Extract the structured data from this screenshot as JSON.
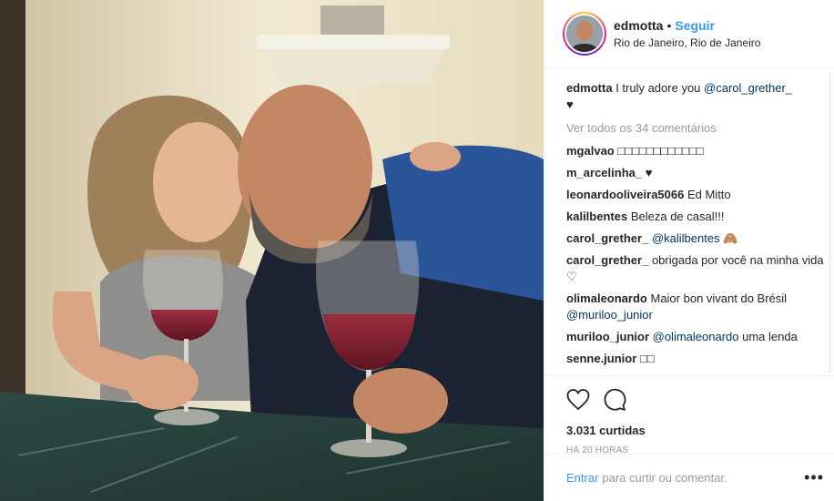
{
  "post": {
    "username": "edmotta",
    "separator": "•",
    "follow_label": "Seguir",
    "location": "Rio de Janeiro, Rio de Janeiro",
    "caption": {
      "user": "edmotta",
      "text": "I truly adore you ",
      "mention": "@carol_grether_",
      "emoji": "♥"
    },
    "view_all": "Ver todos os 34 comentários",
    "comments": [
      {
        "user": "mgalvao",
        "text": "□□□□□□□□□□□□",
        "mention": "",
        "after": ""
      },
      {
        "user": "m_arcelinha_",
        "text": "♥",
        "mention": "",
        "after": ""
      },
      {
        "user": "leonardooliveira5066",
        "text": "Ed Mitto",
        "mention": "",
        "after": ""
      },
      {
        "user": "kalilbentes",
        "text": "Beleza de casal!!!",
        "mention": "",
        "after": ""
      },
      {
        "user": "carol_grether_",
        "text": "",
        "mention": "@kalilbentes",
        "after": " 🙈"
      },
      {
        "user": "carol_grether_",
        "text": "obrigada por você na minha vida ♡",
        "mention": "",
        "after": ""
      },
      {
        "user": "olimaleonardo",
        "text": "Maior bon vivant do Brésil ",
        "mention": "@muriloo_junior",
        "after": ""
      },
      {
        "user": "muriloo_junior",
        "text": "",
        "mention": "@olimaleonardo",
        "after": " uma lenda"
      },
      {
        "user": "senne.junior",
        "text": "□□",
        "mention": "",
        "after": ""
      }
    ],
    "likes": "3.031 curtidas",
    "time": "HÁ 20 HORAS",
    "login_link": "Entrar",
    "add_comment_text": "para curtir ou comentar.",
    "more_label": "•••",
    "icons": {
      "like": "heart-outline-icon",
      "comment": "comment-bubble-icon",
      "more": "more-options-icon"
    }
  }
}
